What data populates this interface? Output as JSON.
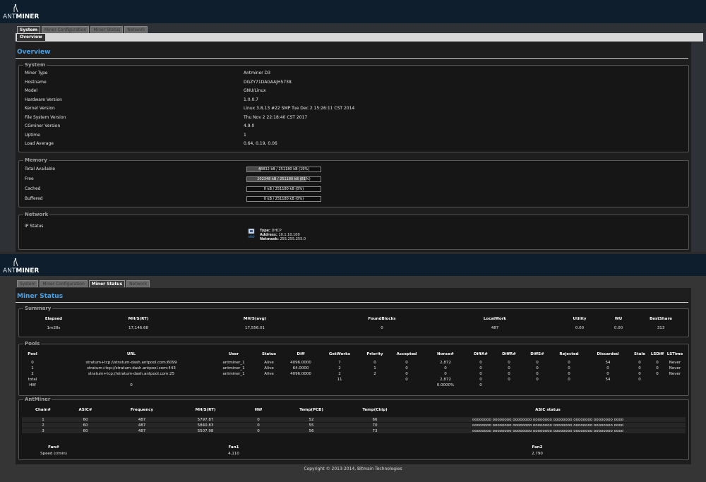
{
  "brand": {
    "prefix": "ANT",
    "suffix": "MINER"
  },
  "top": {
    "tabs": [
      "System",
      "Miner Configuration",
      "Miner Status",
      "Network"
    ],
    "subtab": "Overview",
    "title": "Overview",
    "system": {
      "legend": "System",
      "rows": [
        {
          "label": "Miner Type",
          "value": "Antminer D3"
        },
        {
          "label": "Hostname",
          "value": "DGZY71DAGAAJH5738"
        },
        {
          "label": "Model",
          "value": "GNU/Linux"
        },
        {
          "label": "Hardware Version",
          "value": "1.0.0.7"
        },
        {
          "label": "Kernel Version",
          "value": "Linux 3.8.13 #22 SMP Tue Dec 2 15:26:11 CST 2014"
        },
        {
          "label": "File System Version",
          "value": "Thu Nov 2 22:18:40 CST 2017"
        },
        {
          "label": "CGminer Version",
          "value": "4.9.0"
        },
        {
          "label": "Uptime",
          "value": "1"
        },
        {
          "label": "Load Average",
          "value": "0.64, 0.19, 0.06"
        }
      ]
    },
    "memory": {
      "legend": "Memory",
      "rows": [
        {
          "label": "Total Available",
          "text": "48832 kB / 251180 kB (19%)",
          "fraction": 0.19
        },
        {
          "label": "Free",
          "text": "202348 kB / 251180 kB (81%)",
          "fraction": 0.81
        },
        {
          "label": "Cached",
          "text": "0 kB / 251180 kB (0%)",
          "fraction": 0
        },
        {
          "label": "Buffered",
          "text": "0 kB / 251180 kB (0%)",
          "fraction": 0
        }
      ]
    },
    "network": {
      "legend": "Network",
      "label": "IP Status",
      "icon_caption": "eth0",
      "type_label": "Type:",
      "type_value": "DHCP",
      "address_label": "Address:",
      "address_value": "10.1.10.100",
      "netmask_label": "Netmask:",
      "netmask_value": "255.255.255.0"
    }
  },
  "bottom": {
    "tabs": [
      "System",
      "Miner Configuration",
      "Miner Status",
      "Network"
    ],
    "title": "Miner Status",
    "summary": {
      "legend": "Summary",
      "headers": [
        "Elapsed",
        "MH/S(RT)",
        "MH/S(avg)",
        "FoundBlocks",
        "LocalWork",
        "Utility",
        "WU",
        "BestShare"
      ],
      "values": [
        "1m28s",
        "17,146.68",
        "17,556.01",
        "0",
        "487",
        "0.00",
        "0.00",
        "313"
      ]
    },
    "pools": {
      "legend": "Pools",
      "headers": [
        "Pool",
        "URL",
        "User",
        "Status",
        "Diff",
        "GetWorks",
        "Priority",
        "Accepted",
        "Nonce#",
        "DiffA#",
        "DiffR#",
        "DiffS#",
        "Rejected",
        "Discarded",
        "Stale",
        "LSDiff",
        "LSTime"
      ],
      "rows": [
        [
          "0",
          "stratum+tcp://stratum-dash.antpool.com:6099",
          "antminer_1",
          "Alive",
          "4096.0000",
          "7",
          "0",
          "0",
          "2,872",
          "0",
          "0",
          "0",
          "0",
          "54",
          "0",
          "0",
          "Never"
        ],
        [
          "1",
          "stratum+tcp://stratum-dash.antpool.com:443",
          "antminer_1",
          "Alive",
          "64.0000",
          "2",
          "1",
          "0",
          "0",
          "0",
          "0",
          "0",
          "0",
          "0",
          "0",
          "0",
          "Never"
        ],
        [
          "2",
          "stratum+tcp://stratum-dash.antpool.com:25",
          "antminer_1",
          "Alive",
          "4096.0000",
          "2",
          "2",
          "0",
          "0",
          "0",
          "0",
          "0",
          "0",
          "0",
          "0",
          "0",
          "Never"
        ],
        [
          "total",
          "",
          "",
          "",
          "",
          "11",
          "",
          "0",
          "2,872",
          "0",
          "0",
          "0",
          "0",
          "54",
          "0",
          "",
          ""
        ],
        [
          "HW",
          "0",
          "",
          "",
          "",
          "",
          "",
          "",
          "0.0000%",
          "0",
          "",
          "",
          "",
          "",
          "",
          "",
          ""
        ]
      ]
    },
    "antminer": {
      "legend": "AntMiner",
      "headers": [
        "Chain#",
        "ASIC#",
        "Frequency",
        "MH/S(RT)",
        "HW",
        "Temp(PCB)",
        "Temp(Chip)",
        "ASIC status"
      ],
      "rows": [
        [
          "1",
          "60",
          "487",
          "5797.87",
          "0",
          "52",
          "66",
          "oooooooo oooooooo oooooooo oooooooo oooooooo oooooooo oooooooo oooo"
        ],
        [
          "2",
          "60",
          "487",
          "5840.83",
          "0",
          "55",
          "70",
          "oooooooo oooooooo oooooooo oooooooo oooooooo oooooooo oooooooo oooo"
        ],
        [
          "3",
          "60",
          "487",
          "5507.98",
          "0",
          "56",
          "73",
          "oooooooo oooooooo oooooooo oooooooo oooooooo oooooooo oooooooo oooo"
        ]
      ],
      "fan_headers": [
        "Fan#",
        "Fan1",
        "Fan2"
      ],
      "fan_row": [
        "Speed (r/min)",
        "4,110",
        "2,790"
      ]
    },
    "footer": "Copyright © 2013-2014, Bitmain Technologies"
  }
}
